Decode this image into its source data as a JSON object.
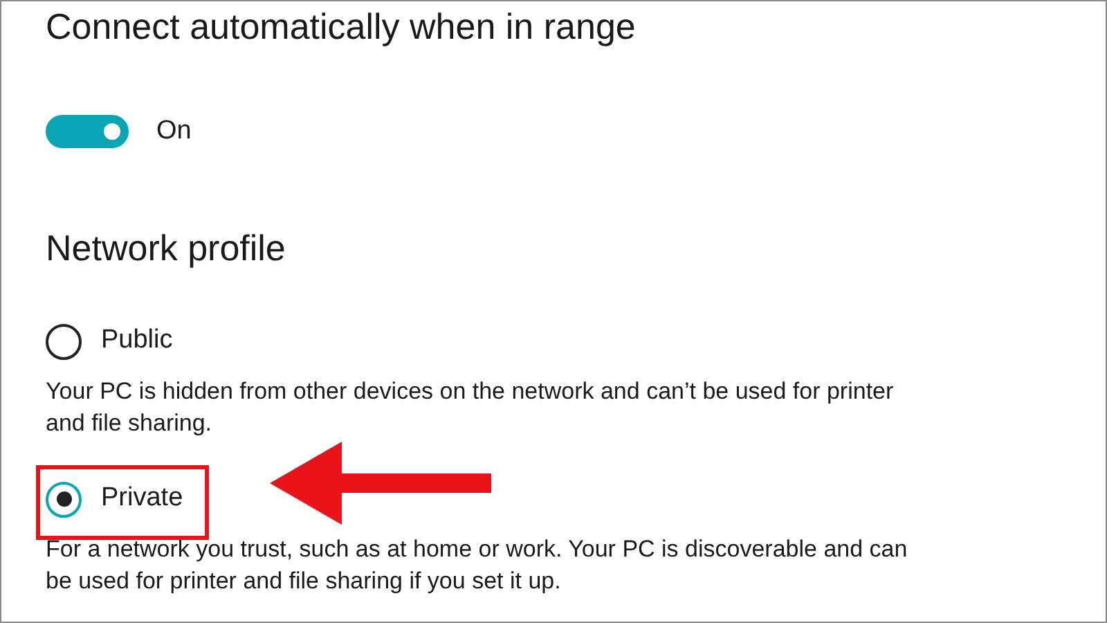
{
  "auto_connect": {
    "title": "Connect automatically when in range",
    "toggle": {
      "on": true,
      "label": "On"
    }
  },
  "network_profile": {
    "title": "Network profile",
    "options": [
      {
        "label": "Public",
        "selected": false,
        "description": "Your PC is hidden from other devices on the network and can’t be used for printer and file sharing."
      },
      {
        "label": "Private",
        "selected": true,
        "description": "For a network you trust, such as at home or work. Your PC is discoverable and can be used for printer and file sharing if you set it up."
      }
    ]
  }
}
